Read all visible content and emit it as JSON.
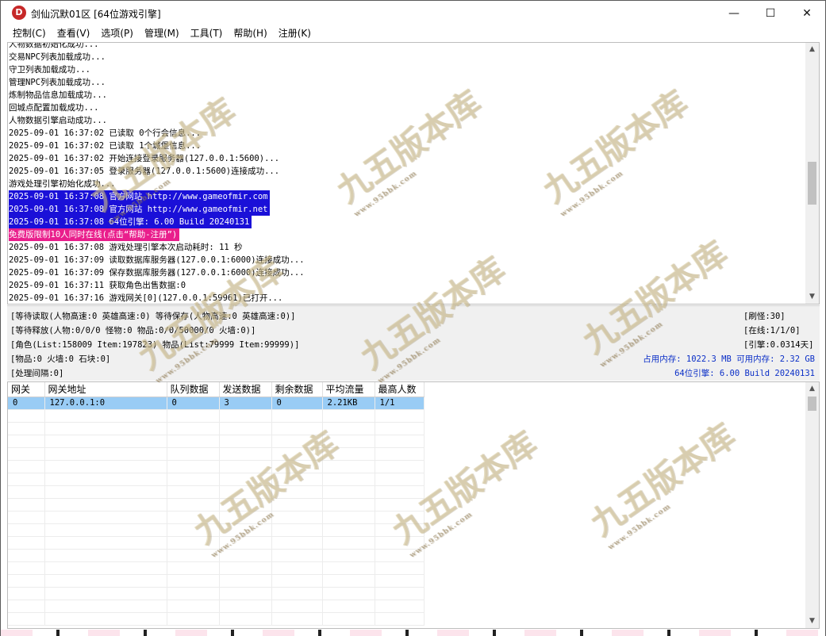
{
  "window": {
    "title": "剑仙沉默01区 [64位游戏引擎]",
    "app_icon_letter": "D",
    "min_glyph": "—",
    "max_glyph": "☐",
    "close_glyph": "✕"
  },
  "menu": [
    "控制(C)",
    "查看(V)",
    "选项(P)",
    "管理(M)",
    "工具(T)",
    "帮助(H)",
    "注册(K)"
  ],
  "log": [
    {
      "text": "人物数据初始化成功...",
      "style": ""
    },
    {
      "text": "交易NPC列表加载成功...",
      "style": ""
    },
    {
      "text": "守卫列表加载成功...",
      "style": ""
    },
    {
      "text": "管理NPC列表加载成功...",
      "style": ""
    },
    {
      "text": "炼制物品信息加载成功...",
      "style": ""
    },
    {
      "text": "回城点配置加载成功...",
      "style": ""
    },
    {
      "text": "人物数据引擎启动成功...",
      "style": ""
    },
    {
      "text": "2025-09-01 16:37:02 已读取 0个行会信息...",
      "style": ""
    },
    {
      "text": "2025-09-01 16:37:02 已读取 1个城堡信息...",
      "style": ""
    },
    {
      "text": "2025-09-01 16:37:02 开始连接登录服务器(127.0.0.1:5600)...",
      "style": ""
    },
    {
      "text": "2025-09-01 16:37:05 登录服务器(127.0.0.1:5600)连接成功...",
      "style": ""
    },
    {
      "text": "游戏处理引擎初始化成功...",
      "style": ""
    },
    {
      "text": "2025-09-01 16:37:08 官方网站 http://www.gameofmir.com",
      "style": "blue"
    },
    {
      "text": "2025-09-01 16:37:08 官方网站 http://www.gameofmir.net",
      "style": "blue"
    },
    {
      "text": "2025-09-01 16:37:08 64位引擎: 6.00 Build 20240131",
      "style": "blue"
    },
    {
      "text": "免费版限制10人同时在线(点击“帮助-注册”)",
      "style": "pink"
    },
    {
      "text": "2025-09-01 16:37:08 游戏处理引擎本次启动耗时: 11 秒",
      "style": ""
    },
    {
      "text": "2025-09-01 16:37:09 读取数据库服务器(127.0.0.1:6000)连接成功...",
      "style": ""
    },
    {
      "text": "2025-09-01 16:37:09 保存数据库服务器(127.0.0.1:6000)连接成功...",
      "style": ""
    },
    {
      "text": "2025-09-01 16:37:11 获取角色出售数据:0",
      "style": ""
    },
    {
      "text": "2025-09-01 16:37:16 游戏网关[0](127.0.0.1:59961)已打开...",
      "style": ""
    }
  ],
  "status": {
    "line1": "[等待读取(人物高速:0 英雄高速:0) 等待保存(人物高速:0 英雄高速:0)]",
    "line2": "[等待释放(人物:0/0/0 怪物:0 物品:0/0/50000/0 火墙:0)]",
    "line3": "[角色(List:158009 Item:197823) 物品(List:79999 Item:99999)]",
    "line4": "[物品:0 火墙:0 石块:0]",
    "line5": "[处理间隔:0]",
    "refresh_monsters": "[刷怪:30]",
    "online": "[在线:1/1/0]",
    "engine_time": "[引擎:0.0314天]",
    "memory": "占用内存: 1022.3 MB 可用内存: 2.32 GB",
    "engine_version": "64位引擎: 6.00 Build 20240131"
  },
  "grid": {
    "columns": [
      "网关",
      "网关地址",
      "队列数据",
      "发送数据",
      "剩余数据",
      "平均流量",
      "最高人数"
    ],
    "rows": [
      [
        "0",
        "127.0.0.1:0",
        "0",
        "3",
        "0",
        "2.21KB",
        "1/1"
      ]
    ]
  },
  "watermark": {
    "text": "九五版本库",
    "url": "www.95bbk.com"
  }
}
